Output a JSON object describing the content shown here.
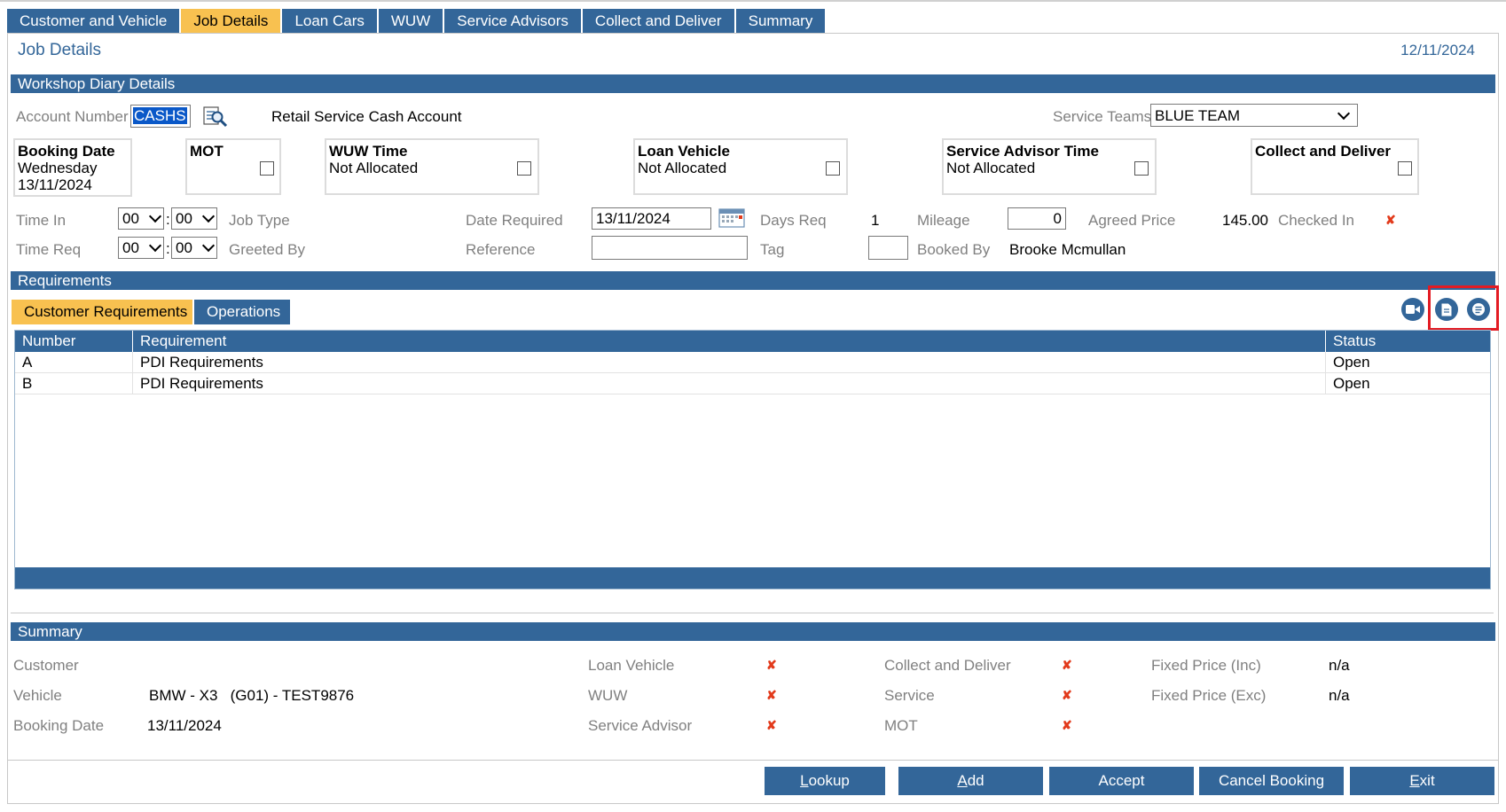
{
  "tabs": [
    {
      "label": "Customer and Vehicle",
      "active": false
    },
    {
      "label": "Job Details",
      "active": true
    },
    {
      "label": "Loan Cars",
      "active": false
    },
    {
      "label": "WUW",
      "active": false
    },
    {
      "label": "Service Advisors",
      "active": false
    },
    {
      "label": "Collect and Deliver",
      "active": false
    },
    {
      "label": "Summary",
      "active": false
    }
  ],
  "page": {
    "title": "Job Details",
    "date": "12/11/2024"
  },
  "workshop": {
    "section_title": "Workshop Diary Details",
    "account_number_label": "Account Number",
    "account_number_value": "CASHS",
    "account_name": "Retail Service Cash Account",
    "service_teams_label": "Service Teams",
    "service_teams_value": "BLUE TEAM",
    "booking_date": {
      "title": "Booking Date",
      "day": "Wednesday",
      "date": "13/11/2024"
    },
    "mot": {
      "title": "MOT"
    },
    "wuw_time": {
      "title": "WUW Time",
      "status": "Not Allocated"
    },
    "loan_vehicle": {
      "title": "Loan Vehicle",
      "status": "Not Allocated"
    },
    "service_advisor_time": {
      "title": "Service Advisor Time",
      "status": "Not Allocated"
    },
    "collect_deliver": {
      "title": "Collect and Deliver"
    },
    "time_in_label": "Time In",
    "time_in_h": "00",
    "time_in_m": "00",
    "time_req_label": "Time Req",
    "time_req_h": "00",
    "time_req_m": "00",
    "colon": ":",
    "job_type_label": "Job Type",
    "greeted_by_label": "Greeted By",
    "date_required_label": "Date Required",
    "date_required_value": "13/11/2024",
    "reference_label": "Reference",
    "days_req_label": "Days Req",
    "days_req_value": "1",
    "tag_label": "Tag",
    "mileage_label": "Mileage",
    "mileage_value": "0",
    "booked_by_label": "Booked By",
    "booked_by_value": "Brooke Mcmullan",
    "agreed_price_label": "Agreed Price",
    "agreed_price_value": "145.00",
    "checked_in_label": "Checked In",
    "cross": "✘"
  },
  "requirements": {
    "section_title": "Requirements",
    "subtabs": [
      "Customer Requirements",
      "Operations"
    ],
    "columns": [
      "Number",
      "Requirement",
      "Status"
    ],
    "rows": [
      {
        "number": "A",
        "requirement": "PDI Requirements",
        "status": "Open"
      },
      {
        "number": "B",
        "requirement": "PDI Requirements",
        "status": "Open"
      }
    ],
    "icons": [
      "video-icon",
      "document-icon",
      "notes-icon"
    ]
  },
  "summary": {
    "section_title": "Summary",
    "customer_label": "Customer",
    "vehicle_label": "Vehicle",
    "vehicle_value": "BMW - X3   (G01) - TEST9876",
    "booking_date_label": "Booking Date",
    "booking_date_value": "13/11/2024",
    "loan_vehicle_label": "Loan Vehicle",
    "wuw_label": "WUW",
    "service_advisor_label": "Service Advisor",
    "collect_deliver_label": "Collect and Deliver",
    "service_label": "Service",
    "mot_label": "MOT",
    "fixed_inc_label": "Fixed Price (Inc)",
    "fixed_inc_value": "n/a",
    "fixed_exc_label": "Fixed Price (Exc)",
    "fixed_exc_value": "n/a"
  },
  "buttons": [
    {
      "label": "Lookup",
      "hotkey": "L",
      "rest": "ookup"
    },
    {
      "label": "Add",
      "hotkey": "A",
      "rest": "dd"
    },
    {
      "label": "Accept",
      "hotkey": "",
      "rest": "Accept"
    },
    {
      "label": "Cancel Booking",
      "hotkey": "",
      "rest": "Cancel Booking"
    },
    {
      "label": "Exit",
      "hotkey": "E",
      "rest": "xit"
    }
  ],
  "colors": {
    "primary": "#336699",
    "active_tab": "#f8c150",
    "cross": "#e23a1b",
    "highlight": "#e31b23"
  }
}
